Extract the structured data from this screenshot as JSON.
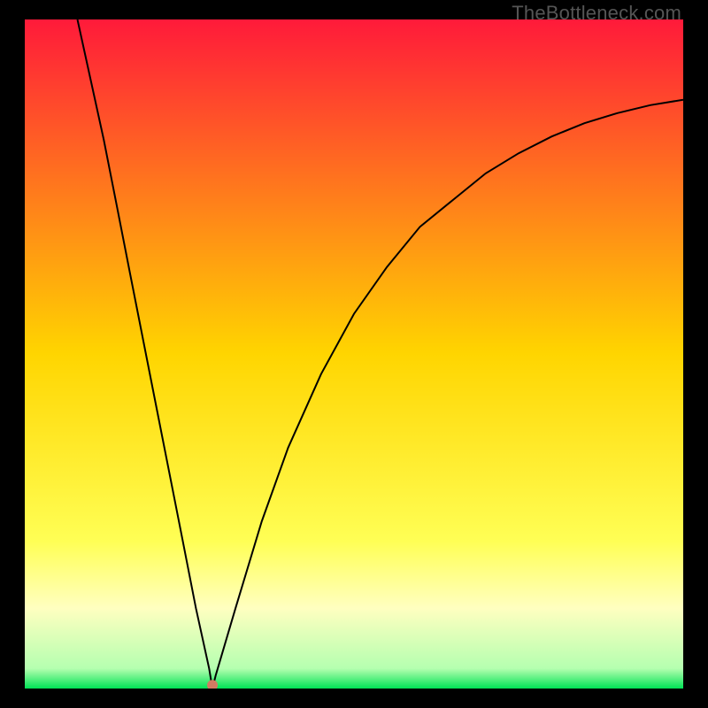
{
  "watermark": "TheBottleneck.com",
  "chart_data": {
    "type": "line",
    "title": "",
    "xlabel": "",
    "ylabel": "",
    "xlim": [
      0,
      100
    ],
    "ylim": [
      0,
      100
    ],
    "grid": false,
    "legend": false,
    "background_gradient_stops": [
      {
        "pos": 0.0,
        "color": "#ff1a3a"
      },
      {
        "pos": 0.5,
        "color": "#ffd500"
      },
      {
        "pos": 0.78,
        "color": "#ffff55"
      },
      {
        "pos": 0.88,
        "color": "#ffffc0"
      },
      {
        "pos": 0.97,
        "color": "#b5ffb0"
      },
      {
        "pos": 1.0,
        "color": "#00e255"
      }
    ],
    "marker": {
      "x": 28.5,
      "y": 0.5,
      "color": "#d47a62",
      "radius_px": 6
    },
    "series": [
      {
        "name": "bottleneck-curve",
        "color": "#000000",
        "x": [
          8,
          10,
          12,
          14,
          16,
          18,
          20,
          22,
          24,
          26,
          28,
          28.5,
          29,
          32,
          36,
          40,
          45,
          50,
          55,
          60,
          65,
          70,
          75,
          80,
          85,
          90,
          95,
          100
        ],
        "values": [
          100,
          91,
          82,
          72,
          62,
          52,
          42,
          32,
          22,
          12,
          3,
          0,
          2,
          12,
          25,
          36,
          47,
          56,
          63,
          69,
          73,
          77,
          80,
          82.5,
          84.5,
          86,
          87.2,
          88
        ]
      }
    ]
  }
}
